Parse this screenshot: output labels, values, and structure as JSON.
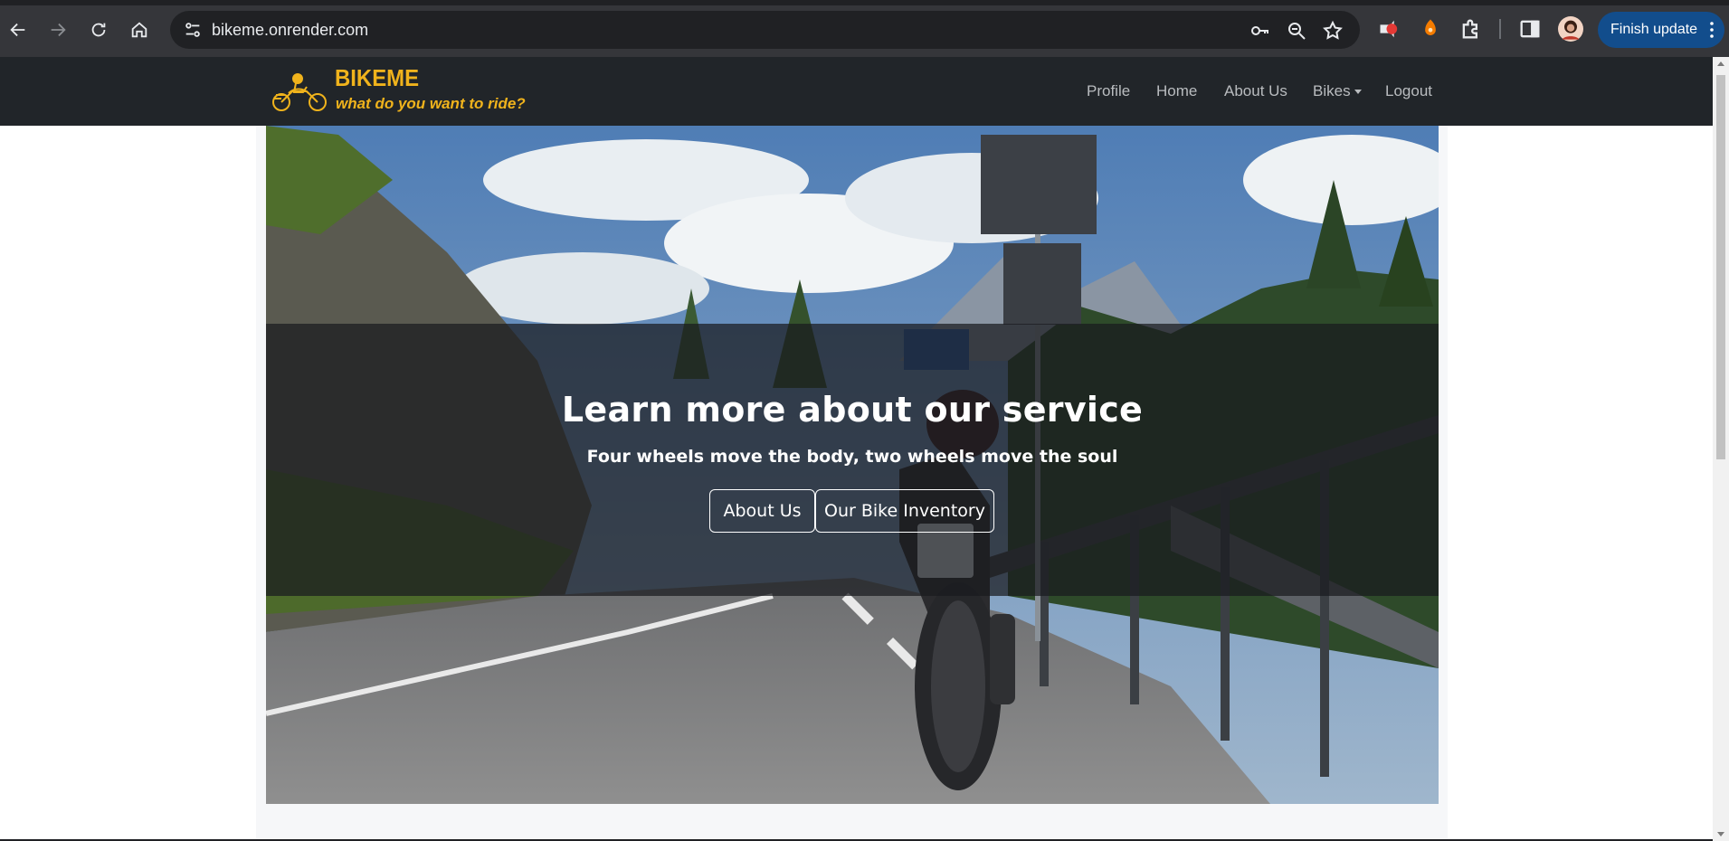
{
  "browser": {
    "url": "bikeme.onrender.com",
    "finish_update_label": "Finish update"
  },
  "site": {
    "brand": {
      "name": "BIKEME",
      "tagline": "what do you want to ride?"
    },
    "nav": [
      {
        "label": "Profile"
      },
      {
        "label": "Home"
      },
      {
        "label": "About Us"
      },
      {
        "label": "Bikes"
      },
      {
        "label": "Logout"
      }
    ]
  },
  "hero": {
    "title": "Learn more about our service",
    "subtitle": "Four wheels move the body, two wheels move the soul",
    "buttons": [
      {
        "label": "About Us"
      },
      {
        "label": "Our Bike Inventory"
      }
    ]
  },
  "colors": {
    "brand": "#f0b31c",
    "navbar": "#212529",
    "chrome": "#35363a"
  }
}
